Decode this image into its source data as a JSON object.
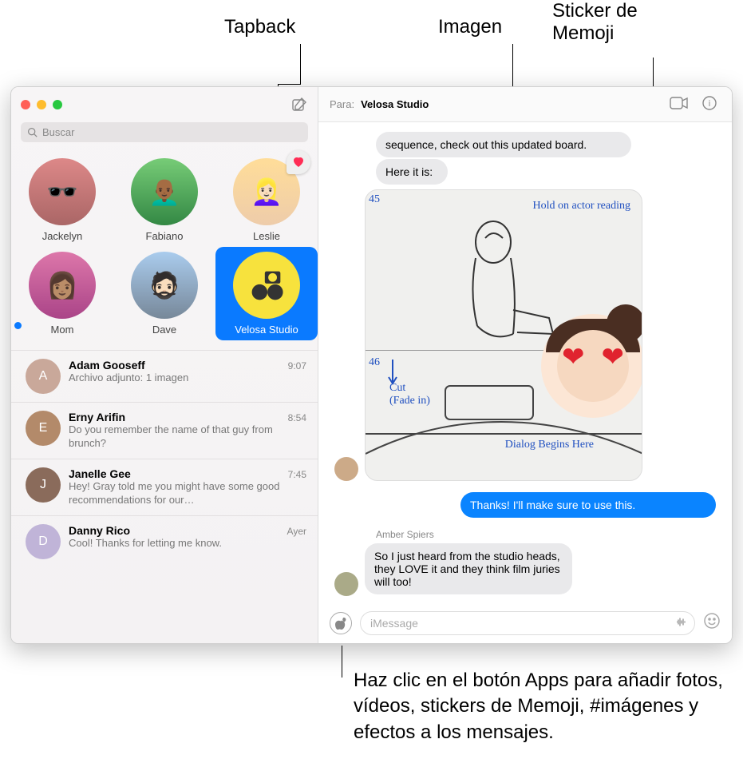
{
  "annotations": {
    "tapback": "Tapback",
    "imagen": "Imagen",
    "memoji": "Sticker de\nMemoji"
  },
  "window": {
    "search_placeholder": "Buscar"
  },
  "pins": [
    {
      "name": "Jackelyn",
      "avatar": "jackelyn",
      "tapback": false,
      "unread": false,
      "selected": false
    },
    {
      "name": "Fabiano",
      "avatar": "fabiano",
      "tapback": false,
      "unread": false,
      "selected": false
    },
    {
      "name": "Leslie",
      "avatar": "leslie",
      "tapback": true,
      "unread": false,
      "selected": false
    },
    {
      "name": "Mom",
      "avatar": "mom",
      "tapback": false,
      "unread": true,
      "selected": false
    },
    {
      "name": "Dave",
      "avatar": "dave",
      "tapback": false,
      "unread": false,
      "selected": false
    },
    {
      "name": "Velosa Studio",
      "avatar": "velosa",
      "tapback": false,
      "unread": false,
      "selected": true
    }
  ],
  "conversations": [
    {
      "name": "Adam Gooseff",
      "time": "9:07",
      "preview": "Archivo adjunto: 1 imagen"
    },
    {
      "name": "Erny Arifin",
      "time": "8:54",
      "preview": "Do you remember the name of that guy from brunch?"
    },
    {
      "name": "Janelle Gee",
      "time": "7:45",
      "preview": "Hey! Gray told me you might have some good recommendations for our…"
    },
    {
      "name": "Danny Rico",
      "time": "Ayer",
      "preview": "Cool! Thanks for letting me know."
    }
  ],
  "to_bar": {
    "label": "Para:",
    "name": "Velosa Studio"
  },
  "thread": {
    "msg1": "sequence, check out this updated board.",
    "msg2": "Here it is:",
    "image_notes": {
      "n1": "Hold on actor reading",
      "n2": "Cut\n(Fade in)",
      "n3": "Dialog Begins Here",
      "frame1": "45",
      "frame2": "46"
    },
    "outgoing": "Thanks! I'll make sure to use this.",
    "sender2": "Amber Spiers",
    "msg3": "So I just heard from the studio heads, they LOVE it and they think film juries will too!"
  },
  "input": {
    "placeholder": "iMessage"
  },
  "caption": "Haz clic en el botón Apps para añadir fotos, vídeos, stickers de Memoji, #imágenes y efectos a los mensajes."
}
